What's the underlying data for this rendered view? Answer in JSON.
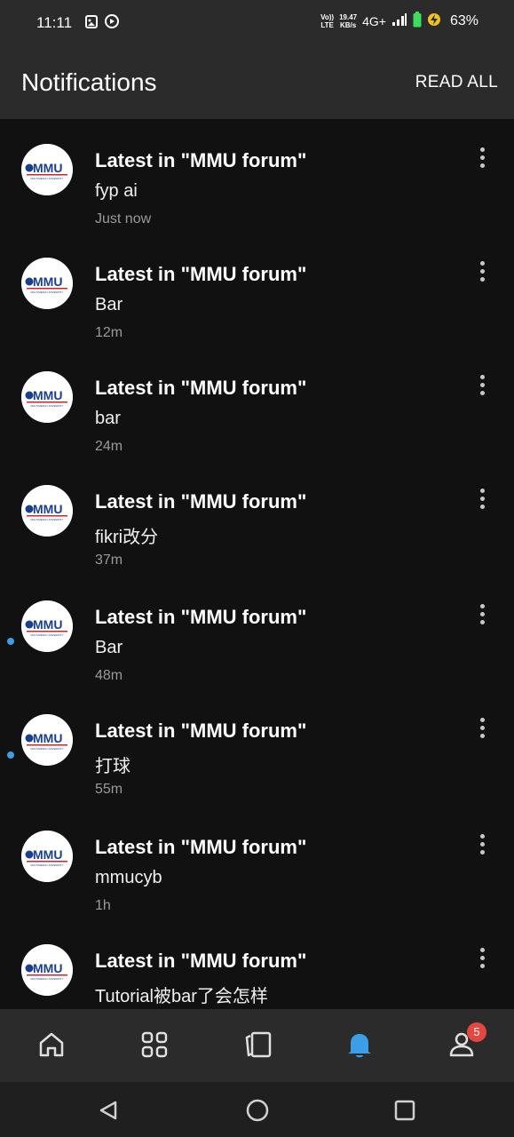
{
  "status_bar": {
    "time": "11:11",
    "network_speed": "19.47",
    "network_unit": "KB/s",
    "volte_top": "Vo))",
    "volte_bottom": "LTE",
    "network_type": "4G+",
    "battery": "63%",
    "icons": [
      "image-icon",
      "play-circle-icon",
      "signal-icon",
      "battery-icon",
      "charging-icon"
    ]
  },
  "header": {
    "title": "Notifications",
    "read_all_label": "READ ALL"
  },
  "avatar_logo": {
    "text": "MMU",
    "subtext": "MULTIMEDIA UNIVERSITY",
    "brand_color": "#1b3f8f",
    "accent_color": "#d2232a"
  },
  "notifications": [
    {
      "title": "Latest in \"MMU forum\"",
      "body": "fyp ai",
      "time": "Just now",
      "unread": false
    },
    {
      "title": "Latest in \"MMU forum\"",
      "body": "Bar",
      "time": "12m",
      "unread": false
    },
    {
      "title": "Latest in \"MMU forum\"",
      "body": "bar",
      "time": "24m",
      "unread": false
    },
    {
      "title": "Latest in \"MMU forum\"",
      "body": "fikri改分",
      "time": "37m",
      "unread": false
    },
    {
      "title": "Latest in \"MMU forum\"",
      "body": "Bar",
      "time": "48m",
      "unread": true
    },
    {
      "title": "Latest in \"MMU forum\"",
      "body": "打球",
      "time": "55m",
      "unread": true
    },
    {
      "title": "Latest in \"MMU forum\"",
      "body": "mmucyb",
      "time": "1h",
      "unread": false
    },
    {
      "title": "Latest in \"MMU forum\"",
      "body": "Tutorial被bar了会怎样",
      "time": "",
      "unread": false
    }
  ],
  "bottom_nav": {
    "items": [
      {
        "icon": "home-icon",
        "active": false
      },
      {
        "icon": "grid-icon",
        "active": false
      },
      {
        "icon": "cards-icon",
        "active": false
      },
      {
        "icon": "bell-icon",
        "active": true
      },
      {
        "icon": "profile-icon",
        "active": false
      }
    ],
    "profile_badge": "5",
    "active_color": "#3c9ee6"
  },
  "system_nav": [
    "back-icon",
    "home-circle-icon",
    "recents-icon"
  ]
}
